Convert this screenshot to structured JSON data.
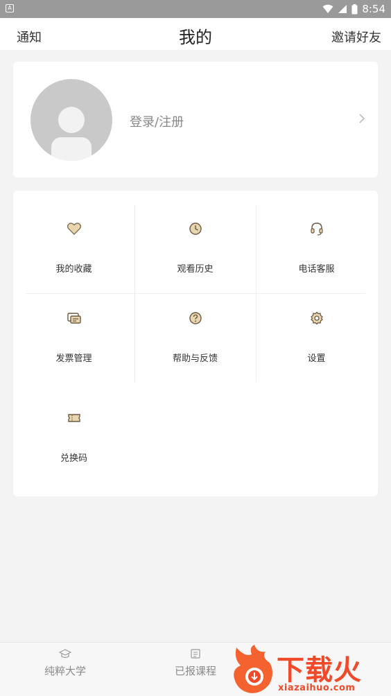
{
  "status_bar": {
    "time": "8:54",
    "notif_glyph": "A"
  },
  "header": {
    "left": "通知",
    "title": "我的",
    "right": "邀请好友"
  },
  "profile": {
    "login_text": "登录/注册"
  },
  "menu": {
    "items": [
      {
        "label": "我的收藏",
        "icon": "heart-icon"
      },
      {
        "label": "观看历史",
        "icon": "clock-icon"
      },
      {
        "label": "电话客服",
        "icon": "headset-icon"
      },
      {
        "label": "发票管理",
        "icon": "invoice-icon"
      },
      {
        "label": "帮助与反馈",
        "icon": "help-icon"
      },
      {
        "label": "设置",
        "icon": "settings-icon"
      },
      {
        "label": "兑换码",
        "icon": "ticket-icon"
      }
    ]
  },
  "bottom_nav": {
    "tabs": [
      {
        "label": "纯粹大学",
        "icon": "graduation-cap-icon"
      },
      {
        "label": "已报课程",
        "icon": "course-icon"
      }
    ]
  },
  "watermark": {
    "text": "下载火",
    "url": "xiazaihuo.com"
  },
  "colors": {
    "accent": "#c9a46a",
    "icon_fill": "#e9d6ae",
    "watermark": "#f14a2a"
  }
}
